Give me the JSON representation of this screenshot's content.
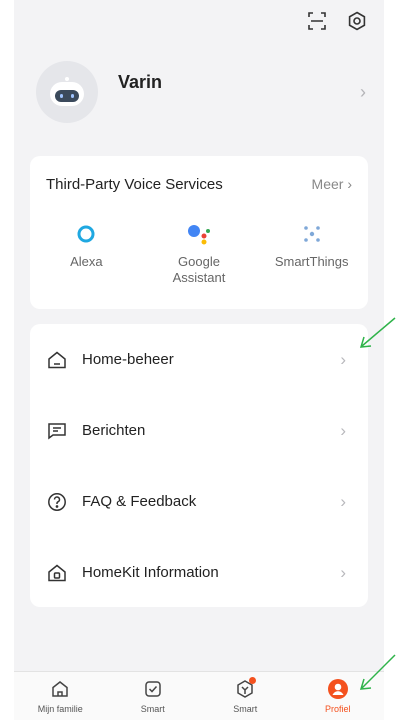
{
  "user": {
    "name": "Varin"
  },
  "voice": {
    "title": "Third-Party Voice Services",
    "more": "Meer",
    "items": [
      {
        "label": "Alexa",
        "icon": "alexa-icon"
      },
      {
        "label": "Google\nAssistant",
        "icon": "google-assistant-icon"
      },
      {
        "label": "SmartThings",
        "icon": "smartthings-icon"
      }
    ]
  },
  "menu": {
    "items": [
      {
        "label": "Home-beheer",
        "icon": "home-icon"
      },
      {
        "label": "Berichten",
        "icon": "message-icon"
      },
      {
        "label": "FAQ & Feedback",
        "icon": "question-icon"
      },
      {
        "label": "HomeKit Information",
        "icon": "homekit-icon"
      }
    ]
  },
  "tabs": [
    {
      "label": "Mijn familie",
      "icon": "home-icon"
    },
    {
      "label": "Smart",
      "icon": "checkbox-icon"
    },
    {
      "label": "Smart",
      "icon": "smart-icon"
    },
    {
      "label": "Profiel",
      "icon": "profile-icon",
      "active": true
    }
  ],
  "colors": {
    "accent": "#f4511e",
    "annotation": "#2fb34a",
    "alexa": "#1fa8e1"
  }
}
